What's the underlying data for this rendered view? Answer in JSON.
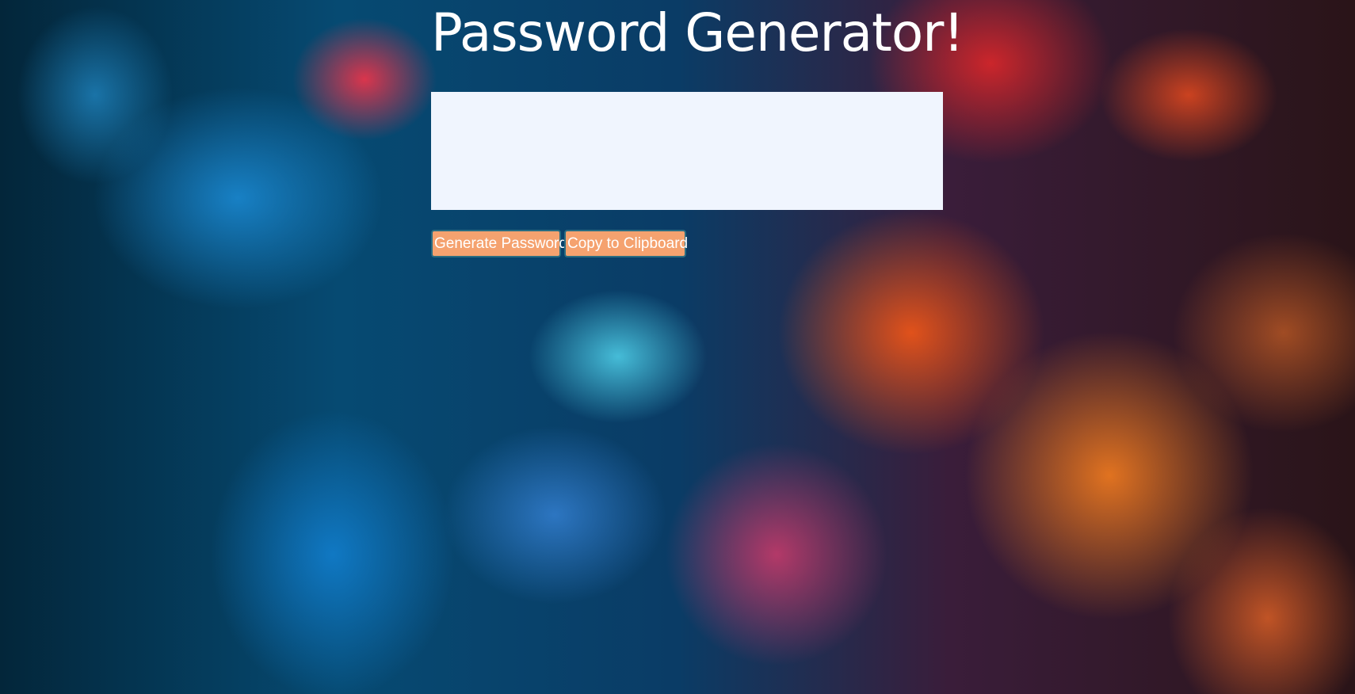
{
  "page": {
    "title": "Password Generator!"
  },
  "password_output": {
    "value": ""
  },
  "actions": {
    "generate_label": "Generate Password",
    "copy_label": "Copy to Clipboard"
  },
  "colors": {
    "button_bg": "#f5a26f",
    "button_border": "#2a6d82",
    "output_bg": "#f0f5fe",
    "title_text": "#ffffff"
  }
}
